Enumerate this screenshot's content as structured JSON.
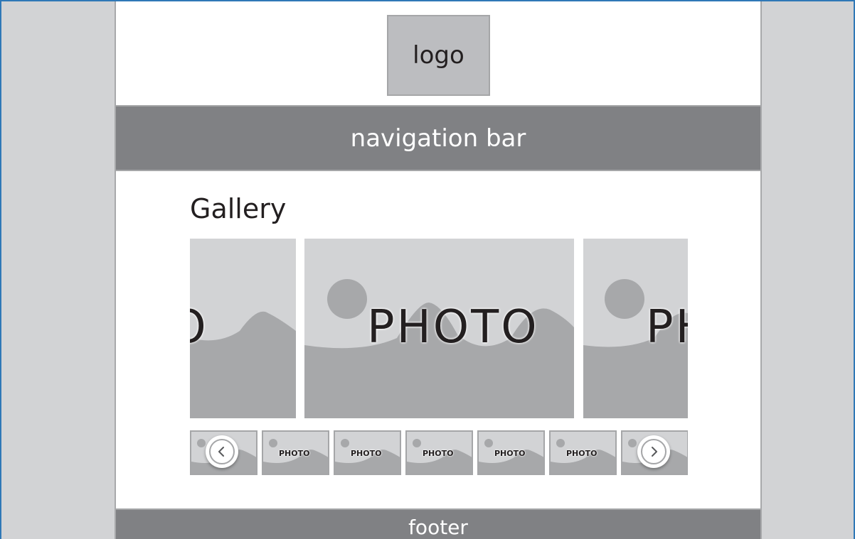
{
  "header": {
    "logo_label": "logo"
  },
  "navigation": {
    "label": "navigation bar"
  },
  "gallery": {
    "title": "Gallery",
    "slides": [
      {
        "label": "PHOTO"
      },
      {
        "label": "PHOTO"
      },
      {
        "label": "PHOTO"
      }
    ],
    "thumbnails": [
      {
        "label": "PHOTO"
      },
      {
        "label": "PHOTO"
      },
      {
        "label": "PHOTO"
      },
      {
        "label": "PHOTO"
      },
      {
        "label": "PHOTO"
      },
      {
        "label": "PHOTO"
      },
      {
        "label": "PHOTO"
      }
    ],
    "prev_icon": "chevron-left-icon",
    "next_icon": "chevron-right-icon"
  },
  "footer": {
    "label": "footer"
  },
  "colors": {
    "frame_border": "#2f78b7",
    "side_background": "#d2d3d5",
    "bar_background": "#808184",
    "photo_background": "#d2d3d5",
    "photo_shape": "#a7a8aa"
  }
}
